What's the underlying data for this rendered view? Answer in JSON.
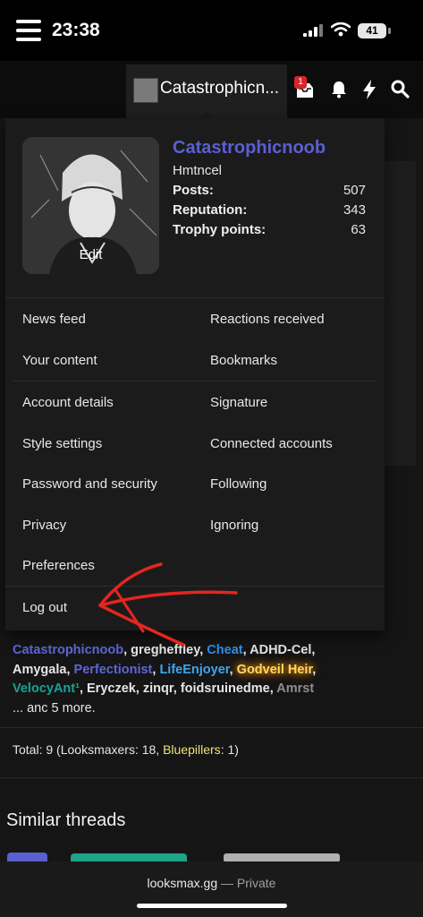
{
  "status_bar": {
    "time": "23:38",
    "battery": "41"
  },
  "nav": {
    "account_name": "Catastrophicn...",
    "inbox_badge": "1",
    "icons": [
      "menu-icon",
      "inbox-icon",
      "bell-icon",
      "bolt-icon",
      "search-icon"
    ]
  },
  "profile": {
    "username": "Catastrophicnoob",
    "user_title": "Hmtncel",
    "edit_label": "Edit",
    "stats": [
      {
        "label": "Posts:",
        "value": "507"
      },
      {
        "label": "Reputation:",
        "value": "343"
      },
      {
        "label": "Trophy points:",
        "value": "63"
      }
    ]
  },
  "menu": {
    "group1": {
      "left": [
        "News feed",
        "Your content"
      ],
      "right": [
        "Reactions received",
        "Bookmarks"
      ]
    },
    "group2": {
      "left": [
        "Account details",
        "Style settings",
        "Password and security",
        "Privacy",
        "Preferences"
      ],
      "right": [
        "Signature",
        "Connected accounts",
        "Following",
        "Ignoring"
      ]
    },
    "logout": "Log out"
  },
  "online": {
    "line1": [
      {
        "text": "Catast",
        "style": "c-blue"
      },
      {
        "text": "rophicnoob",
        "style": "c-blue"
      },
      {
        "text": ", ",
        "style": ""
      },
      {
        "text": "gregheffley",
        "style": ""
      },
      {
        "text": ", ",
        "style": ""
      },
      {
        "text": "Cheat",
        "style": "c-lblue"
      },
      {
        "text": ", ",
        "style": ""
      },
      {
        "text": "ADHD-Cel",
        "style": ""
      },
      {
        "text": ",",
        "style": ""
      }
    ],
    "line2": [
      {
        "text": "Amyg",
        "style": ""
      },
      {
        "text": "ala",
        "style": ""
      },
      {
        "text": ", ",
        "style": ""
      },
      {
        "text": "Perfectionist",
        "style": "c-blue"
      },
      {
        "text": ", ",
        "style": ""
      },
      {
        "text": "LifeEnjoyer",
        "style": "c-sky"
      },
      {
        "text": ", ",
        "style": ""
      },
      {
        "text": "Godveil Heir",
        "style": "c-gold"
      },
      {
        "text": ",",
        "style": ""
      }
    ],
    "line3": [
      {
        "text": "Veloc",
        "style": "c-teal"
      },
      {
        "text": "yAnt¹",
        "style": "c-teal"
      },
      {
        "text": ", ",
        "style": ""
      },
      {
        "text": "Eryczek",
        "style": ""
      },
      {
        "text": ", ",
        "style": ""
      },
      {
        "text": "zinqr",
        "style": ""
      },
      {
        "text": ", ",
        "style": ""
      },
      {
        "text": "foidsruinedme",
        "style": ""
      },
      {
        "text": ", ",
        "style": ""
      },
      {
        "text": "Amrst",
        "style": "c-gray"
      }
    ],
    "more": "... anc  5 more.",
    "total_prefix": "Total:  ",
    "total_count": "9",
    "total_mid": " (Looksmaxers: 18, ",
    "total_blue": "Bluepillers",
    "total_end": ": 1)"
  },
  "similar_threads": "Similar threads",
  "url_bar": {
    "domain": "looksmax.gg",
    "separator": " — ",
    "mode": "Private"
  },
  "colors": {
    "username_accent": "#5a5fd2",
    "badge_red": "#d6262b",
    "annotation_red": "#e3261f"
  }
}
